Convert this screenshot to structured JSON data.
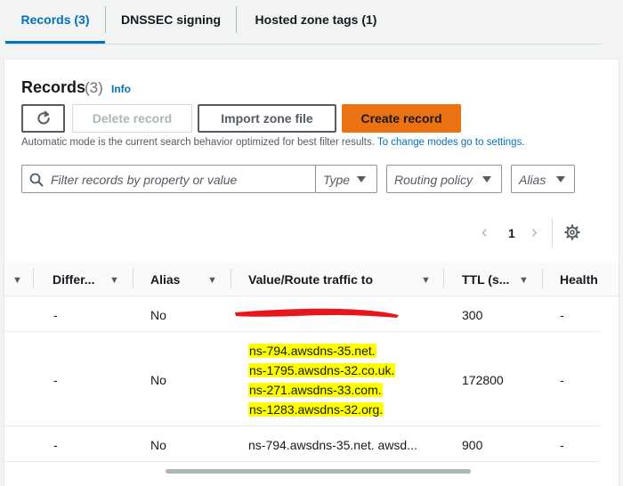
{
  "tabs": [
    {
      "label": "Records (3)"
    },
    {
      "label": "DNSSEC signing"
    },
    {
      "label": "Hosted zone tags (1)"
    }
  ],
  "records": {
    "title": "Records",
    "count": "(3)",
    "info": "Info"
  },
  "actions": {
    "delete_label": "Delete record",
    "import_label": "Import zone file",
    "create_label": "Create record"
  },
  "mode": {
    "text": "Automatic mode is the current search behavior optimized for best filter results.",
    "link": "To change modes go to settings."
  },
  "filters": {
    "search_placeholder": "Filter records by property or value",
    "type": "Type",
    "routing": "Routing policy",
    "alias": "Alias"
  },
  "pagination": {
    "page": "1"
  },
  "columns": {
    "differ": "Differ...",
    "alias": "Alias",
    "value": "Value/Route traffic to",
    "ttl": "TTL (s...",
    "health": "Health"
  },
  "rows": [
    {
      "differ": "-",
      "alias": "No",
      "value": [],
      "ttl": "300",
      "health": "-"
    },
    {
      "differ": "-",
      "alias": "No",
      "value": [
        "ns-794.awsdns-35.net.",
        "ns-1795.awsdns-32.co.uk.",
        "ns-271.awsdns-33.com.",
        "ns-1283.awsdns-32.org."
      ],
      "ttl": "172800",
      "health": "-"
    },
    {
      "differ": "-",
      "alias": "No",
      "value": [
        "ns-794.awsdns-35.net. awsd..."
      ],
      "ttl": "900",
      "health": "-"
    }
  ],
  "colors": {
    "accent": "#0073bb",
    "primary_button": "#ec7211",
    "highlight": "#ffff00",
    "redaction": "#e8161b"
  }
}
